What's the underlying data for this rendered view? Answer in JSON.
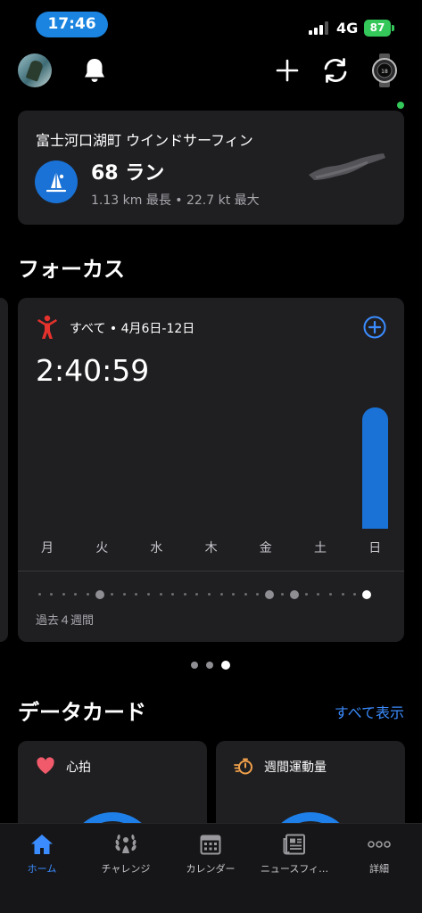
{
  "status_bar": {
    "time": "17:46",
    "network": "4G",
    "battery": "87"
  },
  "activity_card": {
    "title": "富士河口湖町 ウインドサーフィン",
    "count": "68 ラン",
    "stats": "1.13 km 最長 • 22.7 kt 最大"
  },
  "focus": {
    "section_title": "フォーカス",
    "range": "すべて • 4月6日-12日",
    "total_time": "2:40:59",
    "days": [
      "月",
      "火",
      "水",
      "木",
      "金",
      "土",
      "日"
    ],
    "weeks_label": "過去４週間",
    "colors": {
      "accent": "#1a72d6",
      "person": "#e5322d"
    },
    "chart_data": {
      "type": "bar",
      "categories": [
        "月",
        "火",
        "水",
        "木",
        "金",
        "土",
        "日"
      ],
      "values": [
        0,
        0,
        0,
        0,
        0,
        0,
        2.683
      ],
      "ylim": [
        0,
        2.683
      ]
    }
  },
  "data_cards": {
    "section_title": "データカード",
    "see_all": "すべて表示",
    "cards": [
      {
        "label": "心拍",
        "icon": "heart-icon",
        "color": "#f05a6a"
      },
      {
        "label": "週間運動量",
        "icon": "stopwatch-icon",
        "color": "#f0a04a"
      }
    ]
  },
  "tab_bar": {
    "items": [
      {
        "label": "ホーム",
        "icon": "home-icon",
        "active": true
      },
      {
        "label": "チャレンジ",
        "icon": "laurel-icon"
      },
      {
        "label": "カレンダー",
        "icon": "calendar-icon"
      },
      {
        "label": "ニュースフィ…",
        "icon": "newsfeed-icon"
      },
      {
        "label": "詳細",
        "icon": "more-icon"
      }
    ]
  }
}
